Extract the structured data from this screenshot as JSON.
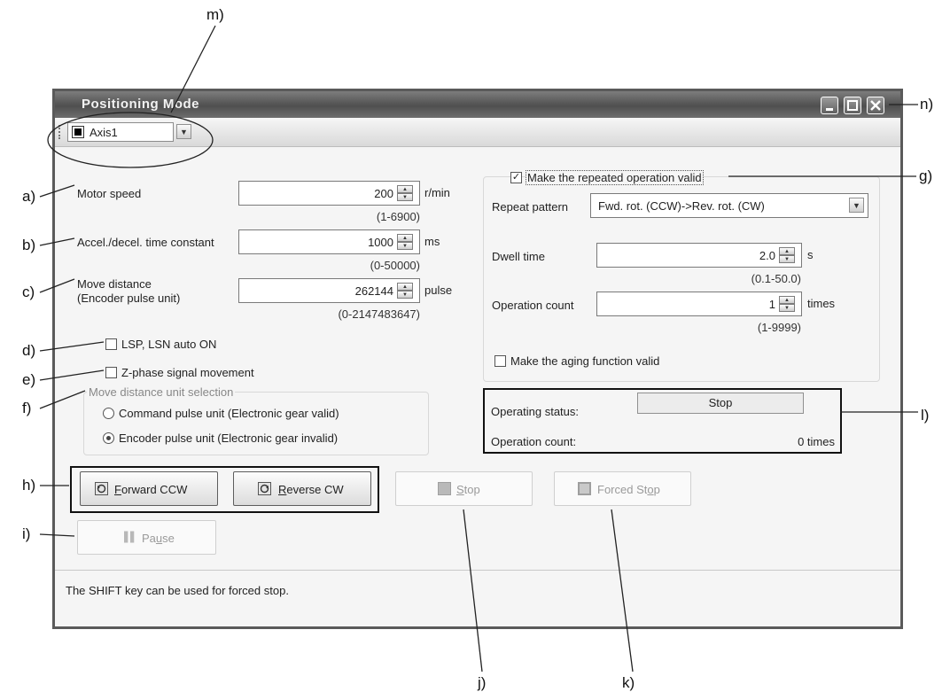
{
  "callouts": {
    "a": "a)",
    "b": "b)",
    "c": "c)",
    "d": "d)",
    "e": "e)",
    "f": "f)",
    "g": "g)",
    "h": "h)",
    "i": "i)",
    "j": "j)",
    "k": "k)",
    "l": "l)",
    "m": "m)",
    "n": "n)"
  },
  "window": {
    "title": "Positioning Mode",
    "axis_selected": "Axis1",
    "footer_note": "The SHIFT key can be used for forced stop."
  },
  "left_params": {
    "motor_speed": {
      "label": "Motor speed",
      "value": "200",
      "unit": "r/min",
      "range": "(1-6900)"
    },
    "accel_decel": {
      "label": "Accel./decel. time constant",
      "value": "1000",
      "unit": "ms",
      "range": "(0-50000)"
    },
    "move_distance": {
      "label_line1": "Move distance",
      "label_line2": "(Encoder pulse unit)",
      "value": "262144",
      "unit": "pulse",
      "range": "(0-2147483647)"
    },
    "lsp_lsn_auto_on": {
      "label": "LSP, LSN auto ON",
      "checked": false
    },
    "z_phase": {
      "label": "Z-phase signal movement",
      "checked": false
    },
    "unit_group": {
      "title": "Move distance unit selection",
      "options": [
        "Command pulse unit (Electronic gear valid)",
        "Encoder pulse unit (Electronic gear invalid)"
      ],
      "selected": "Encoder pulse unit (Electronic gear invalid)"
    }
  },
  "repeat": {
    "valid_label": "Make the repeated operation valid",
    "valid_checked": true,
    "pattern_label": "Repeat pattern",
    "pattern_value": "Fwd. rot. (CCW)->Rev. rot. (CW)",
    "dwell_label": "Dwell time",
    "dwell_value": "2.0",
    "dwell_unit": "s",
    "dwell_range": "(0.1-50.0)",
    "count_label": "Operation count",
    "count_value": "1",
    "count_unit": "times",
    "count_range": "(1-9999)",
    "aging_label": "Make the aging function valid",
    "aging_checked": false
  },
  "status": {
    "operating_label": "Operating status:",
    "operating_value": "Stop",
    "count_label": "Operation count:",
    "count_value": "0 times"
  },
  "buttons": {
    "forward_pre": "",
    "forward_ul": "F",
    "forward_post": "orward CCW",
    "reverse_pre": "",
    "reverse_ul": "R",
    "reverse_post": "everse CW",
    "stop_pre": "",
    "stop_ul": "S",
    "stop_post": "top",
    "forced_pre": "Forced St",
    "forced_ul": "o",
    "forced_post": "p",
    "pause_pre": "Pa",
    "pause_ul": "u",
    "pause_post": "se"
  },
  "colors": {
    "titlebar": "#5b5b5b",
    "window_bg": "#f5f5f5",
    "disabled_text": "#9a9a9a"
  }
}
